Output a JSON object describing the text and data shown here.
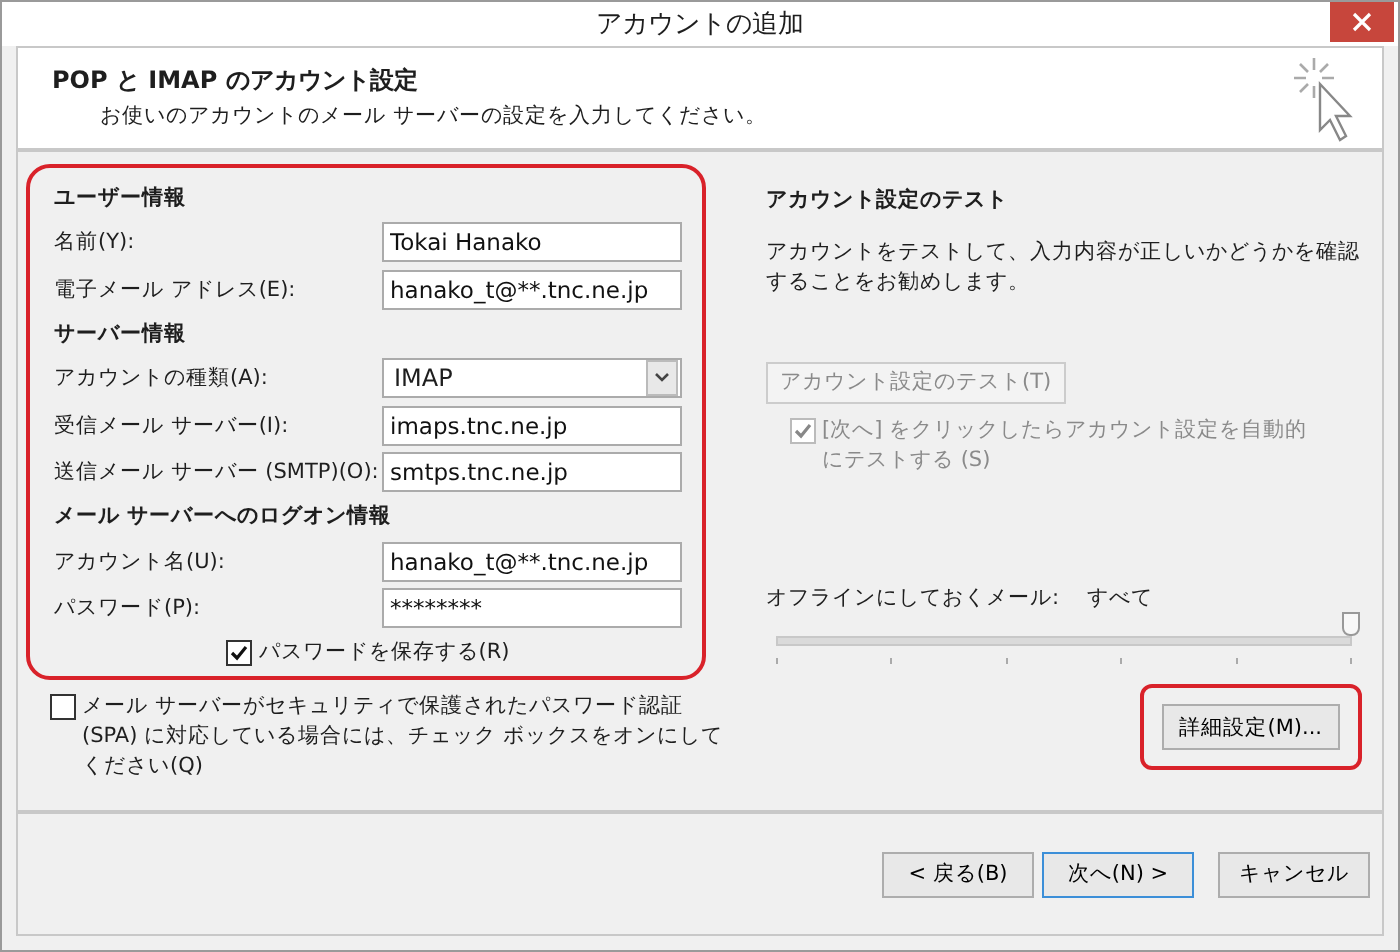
{
  "window": {
    "title": "アカウントの追加"
  },
  "header": {
    "title": "POP と IMAP のアカウント設定",
    "subtitle": "お使いのアカウントのメール サーバーの設定を入力してください。"
  },
  "sections": [
    {
      "heading": "ユーザー情報",
      "fields": [
        {
          "label": "名前(Y):",
          "kind": "text",
          "value": "Tokai Hanako"
        },
        {
          "label": "電子メール アドレス(E):",
          "kind": "text",
          "value": "hanako_t@**.tnc.ne.jp"
        }
      ]
    },
    {
      "heading": "サーバー情報",
      "fields": [
        {
          "label": "アカウントの種類(A):",
          "kind": "select",
          "value": "IMAP"
        },
        {
          "label": "受信メール サーバー(I):",
          "kind": "text",
          "value": "imaps.tnc.ne.jp"
        },
        {
          "label": "送信メール サーバー (SMTP)(O):",
          "kind": "text",
          "value": "smtps.tnc.ne.jp"
        }
      ]
    },
    {
      "heading": "メール サーバーへのログオン情報",
      "fields": [
        {
          "label": "アカウント名(U):",
          "kind": "text",
          "value": "hanako_t@**.tnc.ne.jp"
        },
        {
          "label": "パスワード(P):",
          "kind": "text",
          "value": "********"
        }
      ]
    }
  ],
  "save_password": {
    "label": "パスワードを保存する(R)",
    "checked": true
  },
  "spa": {
    "label": "メール サーバーがセキュリティで保護されたパスワード認証 (SPA) に対応している場合には、チェック ボックスをオンにしてください(Q)",
    "checked": false
  },
  "test": {
    "heading": "アカウント設定のテスト",
    "description": "アカウントをテストして、入力内容が正しいかどうかを確認することをお勧めします。",
    "button": {
      "label": "アカウント設定のテスト(T)",
      "disabled": true
    },
    "auto_test": {
      "label": "[次へ] をクリックしたらアカウント設定を自動的にテストする (S)",
      "checked": true,
      "disabled": true
    }
  },
  "offline": {
    "label": "オフラインにしておくメール:",
    "value": "すべて",
    "level": 1
  },
  "advanced_button": {
    "label": "詳細設定(M)..."
  },
  "footer_buttons": [
    {
      "label": "< 戻る(B)",
      "default": false
    },
    {
      "label": "次へ(N) >",
      "default": true
    },
    {
      "label": "キャンセル",
      "default": false
    }
  ]
}
